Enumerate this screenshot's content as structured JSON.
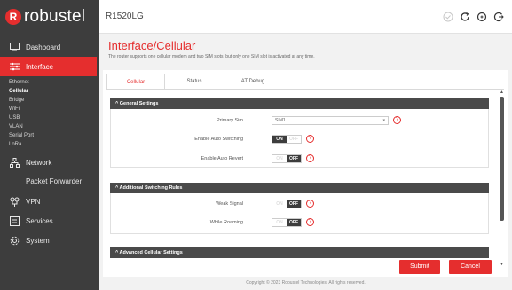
{
  "brand": {
    "logo_text": "robustel"
  },
  "header": {
    "model": "R1520LG"
  },
  "sidebar": {
    "dashboard": "Dashboard",
    "interface": "Interface",
    "interface_sub": [
      "Ethernet",
      "Cellular",
      "Bridge",
      "WiFi",
      "USB",
      "VLAN",
      "Serial Port",
      "LoRa"
    ],
    "network": "Network",
    "packet_forwarder": "Packet Forwarder",
    "vpn": "VPN",
    "services": "Services",
    "system": "System"
  },
  "page": {
    "title": "Interface/Cellular",
    "description": "The router supports one cellular modem and two SIM slots, but only one SIM slot is activated at any time."
  },
  "tabs": [
    "Cellular",
    "Status",
    "AT Debug"
  ],
  "sections": {
    "general": "General Settings",
    "switching": "Additional Switching Rules",
    "advanced": "Advanced Cellular Settings"
  },
  "fields": {
    "primary_sim": {
      "label": "Primary Sim",
      "value": "SIM1"
    },
    "auto_switching": {
      "label": "Enable Auto Switching",
      "on": "ON",
      "off": "OFF"
    },
    "auto_revert": {
      "label": "Enable Auto Revert",
      "on": "ON",
      "off": "OFF"
    },
    "weak_signal": {
      "label": "Weak Signal",
      "on": "ON",
      "off": "OFF"
    },
    "while_roaming": {
      "label": "While Roaming",
      "on": "ON",
      "off": "OFF"
    }
  },
  "help_symbol": "?",
  "buttons": {
    "submit": "Submit",
    "cancel": "Cancel"
  },
  "footer": "Copyright © 2023 Robustel Technologies. All rights reserved.",
  "colors": {
    "accent": "#e52e2e",
    "sidebar": "#3d3d3d",
    "section_header": "#4a4a4a"
  }
}
